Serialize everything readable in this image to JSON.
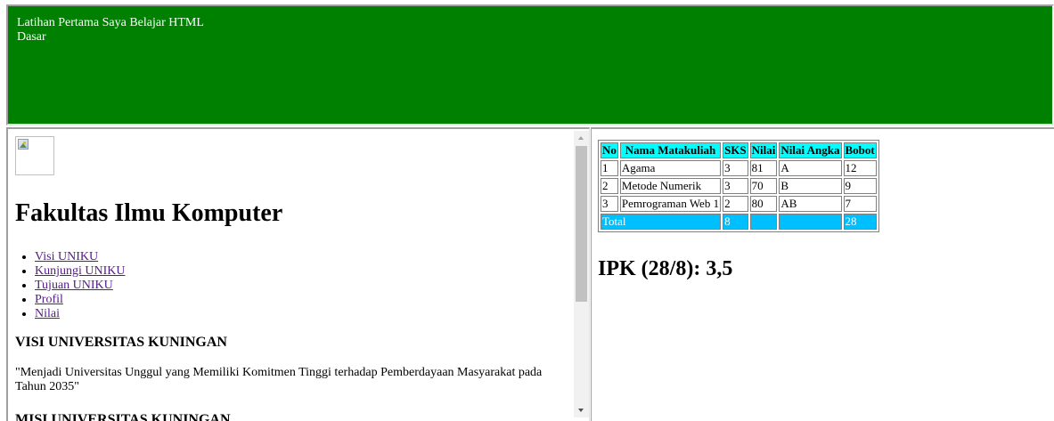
{
  "top": {
    "title": "Latihan Pertama Saya Belajar HTML Dasar",
    "background": "#008000"
  },
  "left": {
    "image_icon": "broken-image-icon",
    "heading": "Fakultas Ilmu Komputer",
    "menu": [
      {
        "label": "Visi UNIKU"
      },
      {
        "label": "Kunjungi UNIKU"
      },
      {
        "label": "Tujuan UNIKU"
      },
      {
        "label": "Profil"
      },
      {
        "label": "Nilai"
      }
    ],
    "visi_heading": "VISI UNIVERSITAS KUNINGAN",
    "visi_text": "\"Menjadi Universitas Unggul yang Memiliki Komitmen Tinggi terhadap Pemberdayaan Masyarakat pada Tahun 2035\"",
    "misi_heading": "MISI UNIVERSITAS KUNINGAN",
    "link_color": "#551a8b"
  },
  "right": {
    "table": {
      "headers": [
        "No",
        "Nama Matakuliah",
        "SKS",
        "Nilai",
        "Nilai Angka",
        "Bobot"
      ],
      "rows": [
        [
          "1",
          "Agama",
          "3",
          "81",
          "A",
          "12"
        ],
        [
          "2",
          "Metode Numerik",
          "3",
          "70",
          "B",
          "9"
        ],
        [
          "3",
          "Pemrograman Web 1",
          "2",
          "80",
          "AB",
          "7"
        ]
      ],
      "total": [
        "Total",
        "8",
        "",
        "",
        "28"
      ],
      "header_color": "#00ffff",
      "total_color": "#00bfff"
    },
    "ipk": "IPK (28/8): 3,5"
  }
}
